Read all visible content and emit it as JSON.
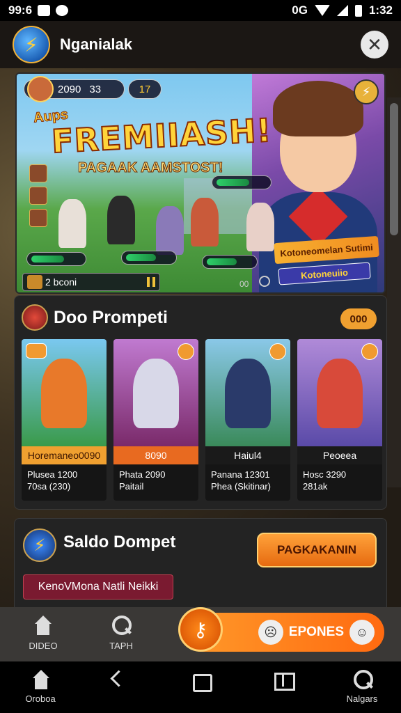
{
  "status_bar": {
    "time_left": "99:6",
    "time_right": "1:32",
    "wifi_label": "0G"
  },
  "header": {
    "title": "Nganialak"
  },
  "banner": {
    "pill_text": "2090",
    "pill_extra": "33",
    "score": "17",
    "headline_small": "Aups",
    "headline": "FREMIIASH!",
    "subline": "PAGAAK AAMSTOST!",
    "promo_tag": "Kotoneomelan Sutimi",
    "promo_tag2": "Kotoneuiio",
    "strip_text": "2 bconi",
    "page_num": "00"
  },
  "competition": {
    "title": "Doo Prompeti",
    "badge": "000",
    "cards": [
      {
        "name": "Horemaneo0090",
        "line1": "Plusea 1200",
        "line2": "70sa (230)",
        "art_color": "#5aa8d8",
        "char_color": "#e8792a"
      },
      {
        "name": "8090",
        "line1": "Phata 2090",
        "line2": "Paitail",
        "art_color": "#b05ab0",
        "char_color": "#d8d8e8"
      },
      {
        "name": "Haiul4",
        "line1": "Panana 12301",
        "line2": "Phea (Skitinar)",
        "art_color": "#3a8a5a",
        "char_color": "#2a3a6a"
      },
      {
        "name": "Peoeea",
        "line1": "Hosc 3290",
        "line2": "281ak",
        "art_color": "#6a5ab8",
        "char_color": "#d84a3a"
      }
    ]
  },
  "wallet": {
    "title": "Saldo Dompet",
    "button": "PAGKAKANIN",
    "note": "KenoVMona Natli Neikki"
  },
  "app_nav": {
    "home": "DIDEO",
    "search": "TAPH",
    "cta": "EPONES"
  },
  "sys_nav": {
    "home": "Oroboa",
    "search": "Nalgars"
  }
}
